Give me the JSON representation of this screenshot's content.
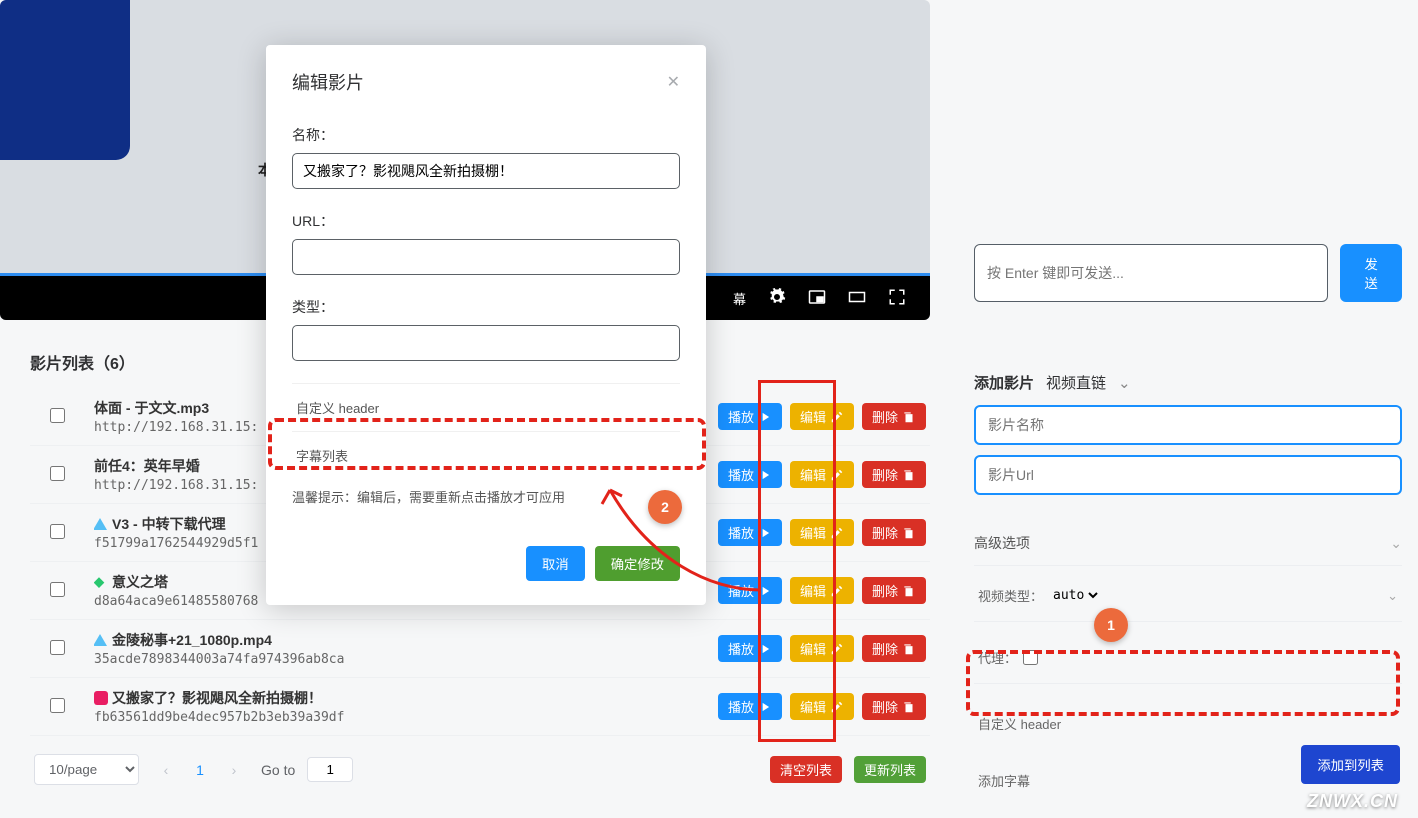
{
  "video": {
    "partial_label": "本",
    "subtitle_btn": "幕",
    "ctrl_pip": "pip",
    "ctrl_gear": "settings",
    "ctrl_wide": "wide",
    "ctrl_fs": "fullscreen"
  },
  "list": {
    "title": "影片列表（6）",
    "rows": [
      {
        "icon": "",
        "title": "体面 - 于文文.mp3",
        "url": "http://192.168.31.15:"
      },
      {
        "icon": "",
        "title": "前任4：英年早婚",
        "url": "http://192.168.31.15:"
      },
      {
        "icon": "ali",
        "title": "V3 - 中转下载代理",
        "url": "f51799a1762544929d5f1"
      },
      {
        "icon": "grn",
        "title": "意义之塔",
        "url": "d8a64aca9e61485580768"
      },
      {
        "icon": "ali",
        "title": "金陵秘事+21_1080p.mp4",
        "url": "35acde7898344003a74fa974396ab8ca"
      },
      {
        "icon": "pink",
        "title": "又搬家了？影视飓风全新拍摄棚！",
        "url": "fb63561dd9be4dec957b2b3eb39a39df"
      }
    ],
    "btn_play": "播放",
    "btn_edit": "编辑",
    "btn_del": "删除"
  },
  "footer": {
    "per_page": "10/page",
    "cur": "1",
    "goto": "Go to",
    "goto_val": "1",
    "clear": "清空列表",
    "refresh": "更新列表"
  },
  "chat": {
    "placeholder": "按 Enter 键即可发送...",
    "send": "发送"
  },
  "add": {
    "heading": "添加影片",
    "mode": "视频直链",
    "ph_name": "影片名称",
    "ph_url": "影片Url",
    "adv": "高级选项",
    "v_type_lbl": "视频类型：",
    "v_type": "auto",
    "proxy": "代理：",
    "custom_header": "自定义 header",
    "add_sub": "添加字幕",
    "submit": "添加到列表"
  },
  "modal": {
    "title": "编辑影片",
    "name_lbl": "名称：",
    "name_val": "又搬家了？影视飓风全新拍摄棚！",
    "url_lbl": "URL：",
    "url_val": "",
    "type_lbl": "类型：",
    "type_val": "",
    "header": "自定义 header",
    "sublist": "字幕列表",
    "tip": "温馨提示：编辑后，需要重新点击播放才可应用",
    "cancel": "取消",
    "ok": "确定修改"
  },
  "annot": {
    "n1": "1",
    "n2": "2"
  },
  "watermark": "ZNWX.CN"
}
